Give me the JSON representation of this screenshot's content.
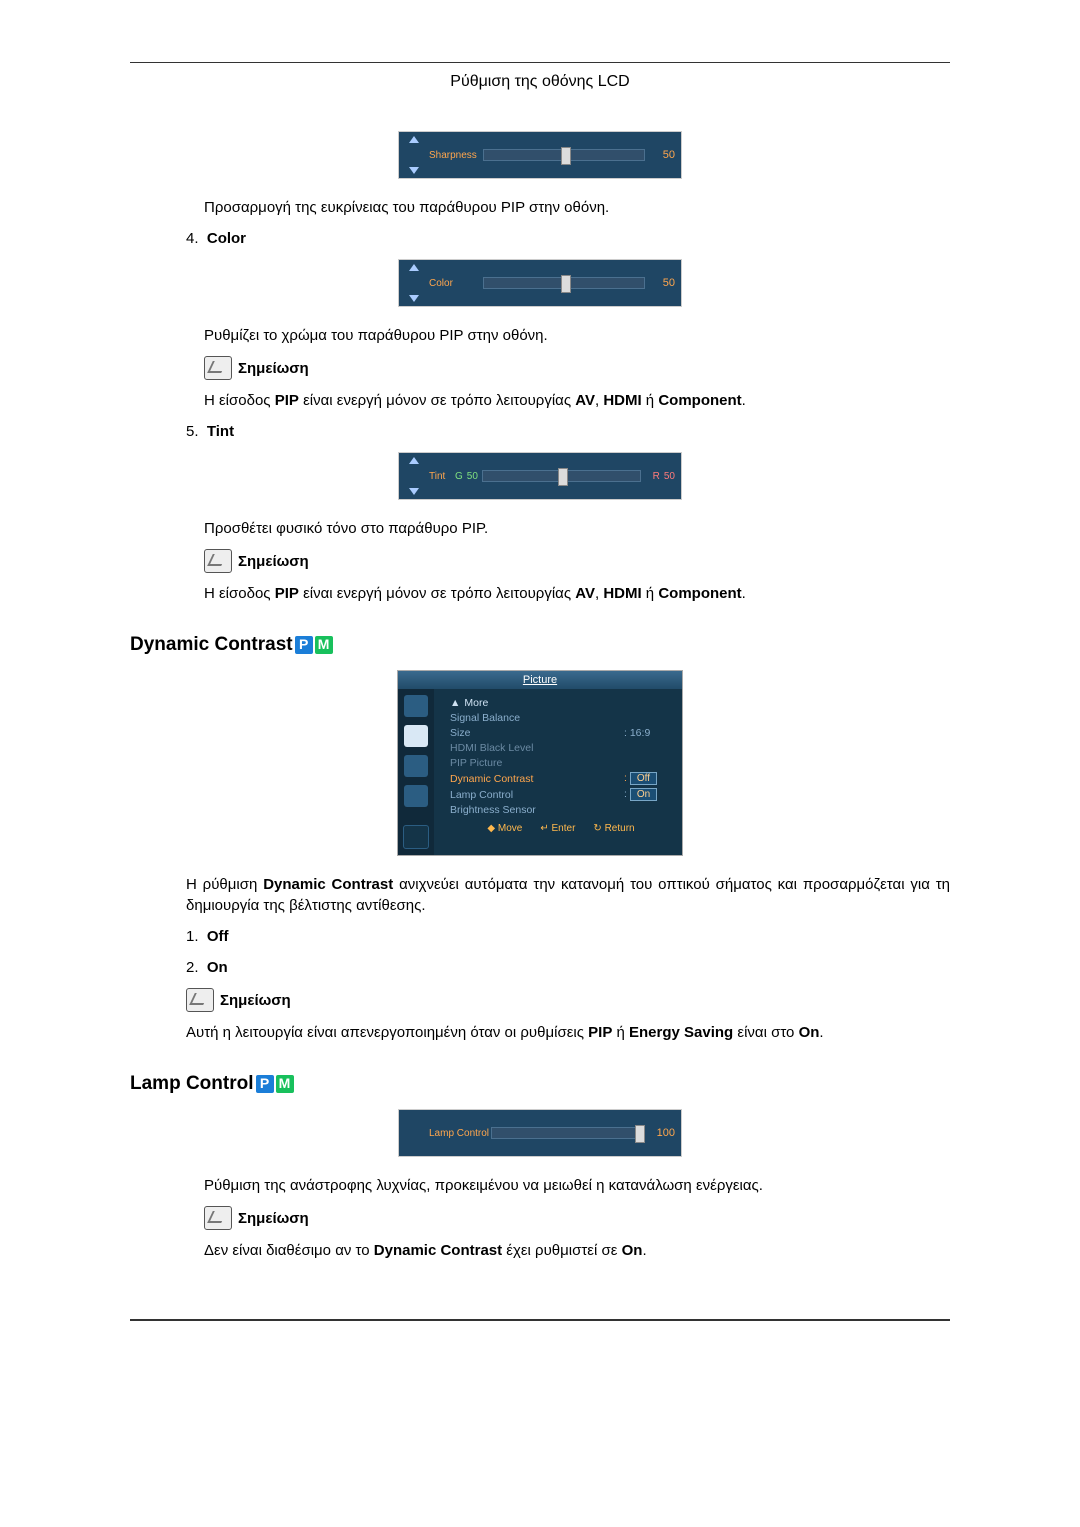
{
  "page_title": "Ρύθμιση της οθόνης LCD",
  "sharpness": {
    "label": "Sharpness",
    "value": "50",
    "desc": "Προσαρμογή της ευκρίνειας του παράθυρου PIP στην οθόνη."
  },
  "color": {
    "num": "4.",
    "heading": "Color",
    "label": "Color",
    "value": "50",
    "desc": "Ρυθμίζει το χρώμα του παράθυρου PIP στην οθόνη.",
    "note_label": "Σημείωση",
    "note_text_a": "Η είσοδος ",
    "note_text_b": "PIP",
    "note_text_c": " είναι ενεργή μόνον σε τρόπο λειτουργίας ",
    "note_text_d": "AV",
    "note_text_e": ", ",
    "note_text_f": "HDMI",
    "note_text_g": " ή ",
    "note_text_h": "Component",
    "note_text_i": "."
  },
  "tint": {
    "num": "5.",
    "heading": "Tint",
    "label": "Tint",
    "g_label": "G",
    "g_value": "50",
    "r_label": "R",
    "r_value": "50",
    "desc": "Προσθέτει φυσικό τόνο στο παράθυρο PIP.",
    "note_label": "Σημείωση",
    "note_text_a": "Η είσοδος ",
    "note_text_b": "PIP",
    "note_text_c": " είναι ενεργή μόνον σε τρόπο λειτουργίας ",
    "note_text_d": "AV",
    "note_text_e": ", ",
    "note_text_f": "HDMI",
    "note_text_g": " ή ",
    "note_text_h": "Component",
    "note_text_i": "."
  },
  "dynamic": {
    "title": "Dynamic Contrast",
    "osd": {
      "menu_title": "Picture",
      "rows": {
        "more": "More",
        "signal_balance": "Signal Balance",
        "size": "Size",
        "size_val_sep": ":",
        "size_val": "16:9",
        "hdmi_black": "HDMI Black Level",
        "pip_picture": "PIP Picture",
        "dyn_contrast": "Dynamic Contrast",
        "dyn_val": "Off",
        "lamp_control": "Lamp Control",
        "lamp_val": "On",
        "brightness_sensor": "Brightness Sensor"
      },
      "footer": {
        "move": "Move",
        "enter": "Enter",
        "ret": "Return"
      }
    },
    "desc_a": "Η ρύθμιση ",
    "desc_b": "Dynamic Contrast",
    "desc_c": " ανιχνεύει αυτόματα την κατανομή του οπτικού σήματος και προσαρμόζεται για τη δημιουργία της βέλτιστης αντίθεσης.",
    "list1_num": "1.",
    "list1_label": "Off",
    "list2_num": "2.",
    "list2_label": "On",
    "note_label": "Σημείωση",
    "note_text_a": "Αυτή η λειτουργία είναι απενεργοποιημένη όταν οι ρυθμίσεις ",
    "note_text_b": "PIP",
    "note_text_c": " ή ",
    "note_text_d": "Energy Saving",
    "note_text_e": " είναι στο ",
    "note_text_f": "On",
    "note_text_g": "."
  },
  "lamp": {
    "title": "Lamp Control",
    "label": "Lamp Control",
    "value": "100",
    "desc": "Ρύθμιση της ανάστροφης λυχνίας, προκειμένου να μειωθεί η κατανάλωση ενέργειας.",
    "note_label": "Σημείωση",
    "note2_a": "Δεν είναι διαθέσιμο αν το ",
    "note2_b": "Dynamic Contrast",
    "note2_c": " έχει ρυθμιστεί σε ",
    "note2_d": "On",
    "note2_e": "."
  },
  "pm": {
    "p": "P",
    "m": "M"
  },
  "chart_data": [
    {
      "type": "table",
      "title": "Sharpness slider",
      "categories": [
        "Sharpness"
      ],
      "values": [
        50
      ],
      "ylim": [
        0,
        100
      ]
    },
    {
      "type": "table",
      "title": "Color slider",
      "categories": [
        "Color"
      ],
      "values": [
        50
      ],
      "ylim": [
        0,
        100
      ]
    },
    {
      "type": "table",
      "title": "Tint slider",
      "categories": [
        "G",
        "R"
      ],
      "values": [
        50,
        50
      ],
      "ylim": [
        0,
        100
      ]
    },
    {
      "type": "table",
      "title": "Lamp Control slider",
      "categories": [
        "Lamp Control"
      ],
      "values": [
        100
      ],
      "ylim": [
        0,
        100
      ]
    }
  ]
}
